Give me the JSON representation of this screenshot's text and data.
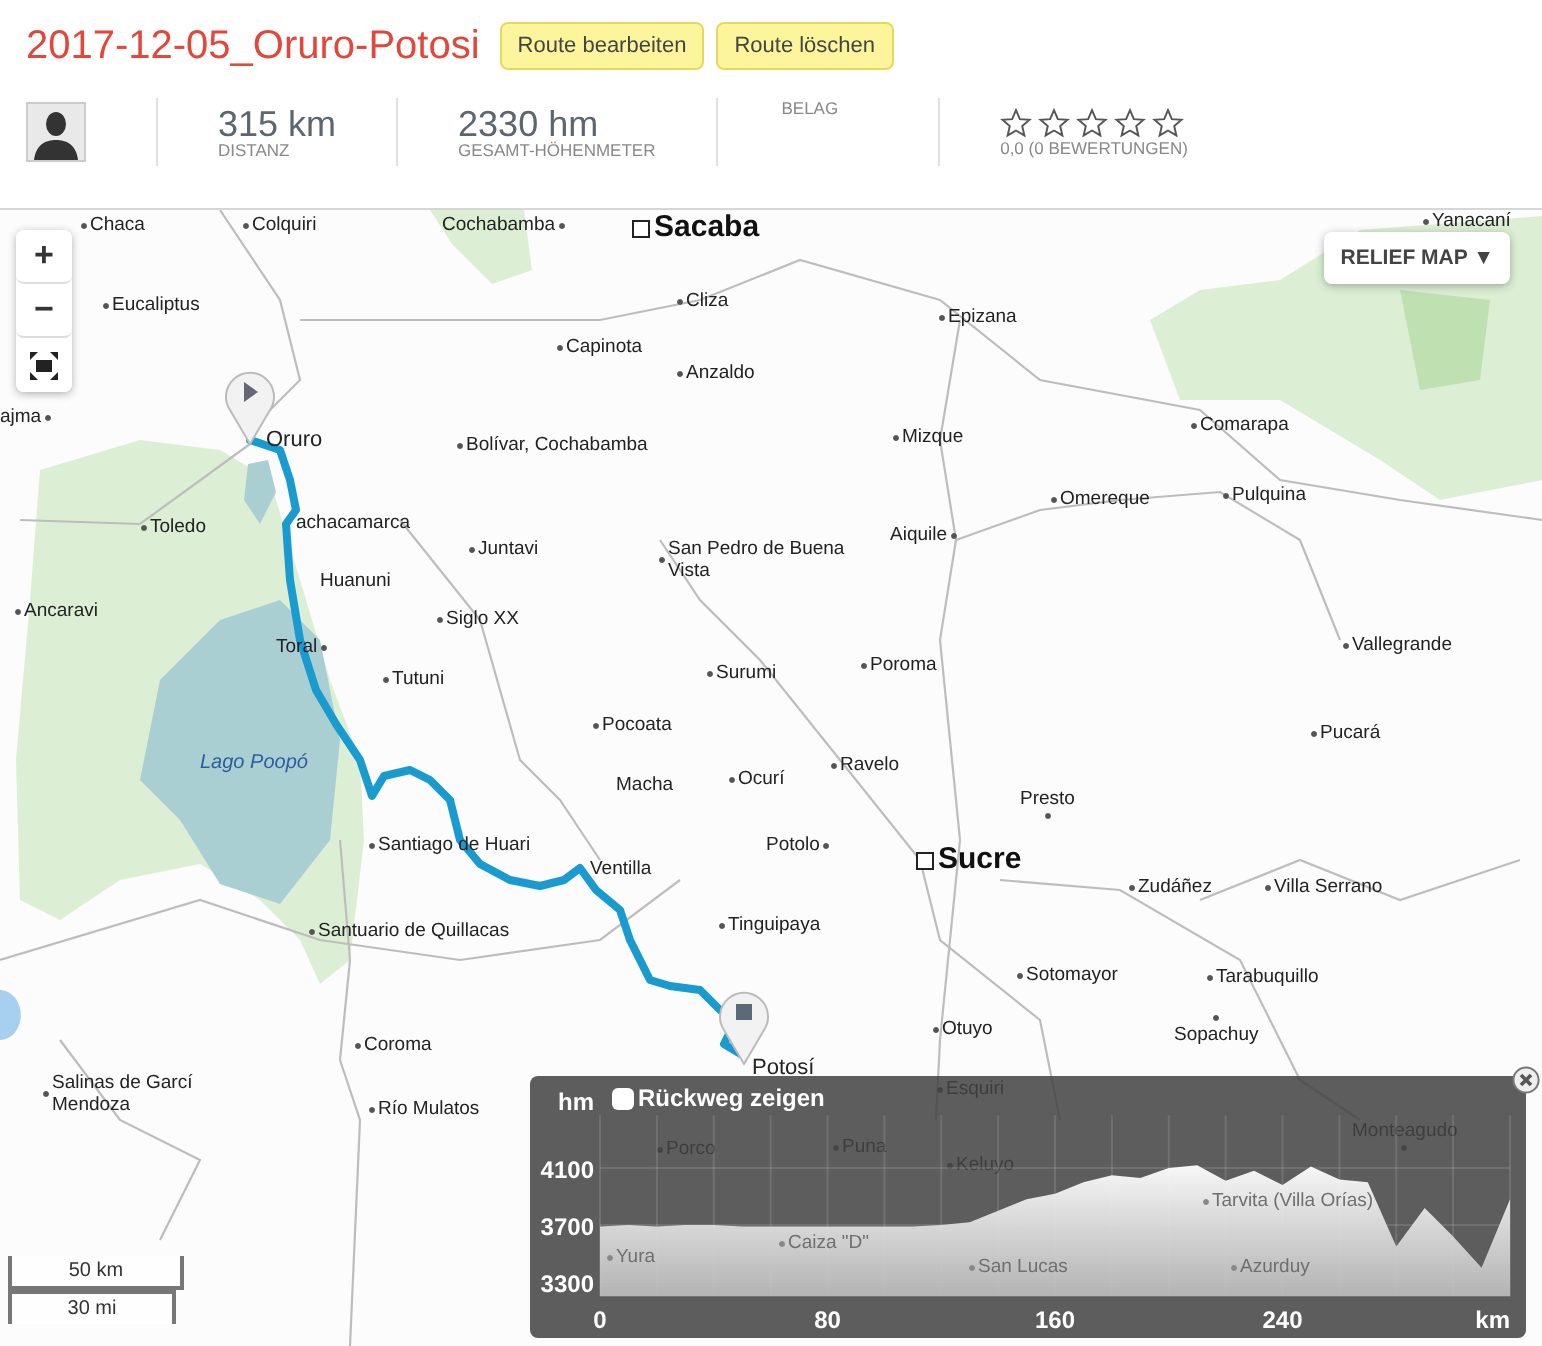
{
  "route": {
    "title": "2017-12-05_Oruro-Potosi",
    "actions": [
      "Route bearbeiten",
      "Route löschen"
    ]
  },
  "stats": [
    {
      "kind": "avatar"
    },
    {
      "kind": "metric",
      "value": "315 km",
      "label": "DISTANZ"
    },
    {
      "kind": "metric",
      "value": "2330 hm",
      "label": "GESAMT-HÖHENMETER"
    },
    {
      "kind": "label",
      "label": "BELAG"
    },
    {
      "kind": "rating",
      "stars": 0,
      "label": "0,0 (0 BEWERTUNGEN)"
    }
  ],
  "map": {
    "zoom_controls": [
      "+",
      "−"
    ],
    "layer_button": "RELIEF MAP ▼",
    "scale": [
      "50 km",
      "30 mi"
    ],
    "places": [
      {
        "name": "Chaca",
        "kind": "town"
      },
      {
        "name": "Colquiri",
        "kind": "town"
      },
      {
        "name": "Cochabamba",
        "kind": "town"
      },
      {
        "name": "Sacaba",
        "kind": "city"
      },
      {
        "name": "Eucaliptus",
        "kind": "town"
      },
      {
        "name": "Cliza",
        "kind": "town"
      },
      {
        "name": "Capinota",
        "kind": "town"
      },
      {
        "name": "Anzaldo",
        "kind": "town"
      },
      {
        "name": "ajma",
        "kind": "town"
      },
      {
        "name": "Oruro",
        "kind": "town"
      },
      {
        "name": "Bolívar, Cochabamba",
        "kind": "town"
      },
      {
        "name": "Toledo",
        "kind": "town"
      },
      {
        "name": "achacamarca",
        "kind": "town"
      },
      {
        "name": "Juntavi",
        "kind": "town"
      },
      {
        "name": "San Pedro de Buena Vista",
        "kind": "town"
      },
      {
        "name": "Huanuni",
        "kind": "town"
      },
      {
        "name": "Ancaravi",
        "kind": "town"
      },
      {
        "name": "Siglo XX",
        "kind": "town"
      },
      {
        "name": "Toral",
        "kind": "town"
      },
      {
        "name": "Tutuni",
        "kind": "town"
      },
      {
        "name": "Surumi",
        "kind": "town"
      },
      {
        "name": "Pocoata",
        "kind": "town"
      },
      {
        "name": "Lago Poopó",
        "kind": "lake"
      },
      {
        "name": "Yanacaní",
        "kind": "town"
      },
      {
        "name": "Epizana",
        "kind": "town"
      },
      {
        "name": "Comarapa",
        "kind": "town"
      },
      {
        "name": "Mizque",
        "kind": "town"
      },
      {
        "name": "Omereque",
        "kind": "town"
      },
      {
        "name": "Pulquina",
        "kind": "town"
      },
      {
        "name": "Aiquile",
        "kind": "town"
      },
      {
        "name": "Poroma",
        "kind": "town"
      },
      {
        "name": "Vallegrande",
        "kind": "town"
      },
      {
        "name": "Pucará",
        "kind": "town"
      },
      {
        "name": "Macha",
        "kind": "town"
      },
      {
        "name": "Ocurí",
        "kind": "town"
      },
      {
        "name": "Ravelo",
        "kind": "town"
      },
      {
        "name": "Potolo",
        "kind": "town"
      },
      {
        "name": "Presto",
        "kind": "town"
      },
      {
        "name": "Sucre",
        "kind": "city"
      },
      {
        "name": "Santiago de Huari",
        "kind": "town"
      },
      {
        "name": "Ventilla",
        "kind": "town"
      },
      {
        "name": "Tinguipaya",
        "kind": "town"
      },
      {
        "name": "Santuario de Quillacas",
        "kind": "town"
      },
      {
        "name": "Zudáñez",
        "kind": "town"
      },
      {
        "name": "Villa Serrano",
        "kind": "town"
      },
      {
        "name": "Sotomayor",
        "kind": "town"
      },
      {
        "name": "Tarabuquillo",
        "kind": "town"
      },
      {
        "name": "Coroma",
        "kind": "town"
      },
      {
        "name": "Salinas de Garcí Mendoza",
        "kind": "town"
      },
      {
        "name": "Río Mulatos",
        "kind": "town"
      },
      {
        "name": "Otuyo",
        "kind": "town"
      },
      {
        "name": "Sopachuy",
        "kind": "town"
      },
      {
        "name": "Potosí",
        "kind": "town"
      },
      {
        "name": "Esquiri",
        "kind": "town"
      },
      {
        "name": "Porco",
        "kind": "town"
      },
      {
        "name": "Puna",
        "kind": "town"
      },
      {
        "name": "Keluyo",
        "kind": "town"
      },
      {
        "name": "Monteagudo",
        "kind": "town"
      },
      {
        "name": "Caiza \"D\"",
        "kind": "town"
      },
      {
        "name": "Tarvita (Villa Orías)",
        "kind": "town"
      },
      {
        "name": "Yura",
        "kind": "town"
      },
      {
        "name": "San Lucas",
        "kind": "town"
      },
      {
        "name": "Azurduy",
        "kind": "town"
      }
    ]
  },
  "elevation": {
    "show_return": {
      "label": "Rückweg zeigen",
      "checked": false
    },
    "chart_data": {
      "type": "area",
      "xlabel": "km",
      "ylabel": "hm",
      "x": [
        0,
        10,
        20,
        30,
        40,
        50,
        60,
        70,
        80,
        90,
        100,
        110,
        120,
        130,
        140,
        150,
        160,
        170,
        180,
        190,
        200,
        210,
        220,
        230,
        240,
        250,
        260,
        270,
        280,
        290,
        300,
        310,
        320
      ],
      "values": [
        3690,
        3700,
        3690,
        3700,
        3700,
        3690,
        3690,
        3690,
        3690,
        3690,
        3690,
        3690,
        3700,
        3720,
        3800,
        3880,
        3920,
        4000,
        4050,
        4030,
        4100,
        4120,
        4010,
        4080,
        3980,
        4110,
        4020,
        4000,
        3550,
        3820,
        3620,
        3400,
        3880
      ],
      "grid": true,
      "xlim": [
        0,
        320
      ],
      "ylim": [
        3200,
        4470
      ],
      "xticks": [
        0,
        80,
        160,
        240
      ],
      "yticks": [
        3300,
        3700,
        4100
      ]
    }
  }
}
